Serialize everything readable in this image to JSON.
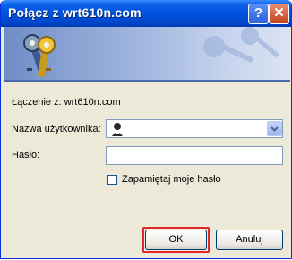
{
  "window": {
    "title": "Połącz z wrt610n.com",
    "help_glyph": "?",
    "close_glyph": "✕"
  },
  "dialog": {
    "connecting_text": "Łączenie z: wrt610n.com",
    "username_label": "Nazwa użytkownika:",
    "password_label": "Hasło:",
    "remember_label": "Zapamiętaj moje hasło",
    "ok_label": "OK",
    "cancel_label": "Anuluj",
    "remember_checked": false
  },
  "colors": {
    "title_bar": "#0053e0",
    "highlight": "#e3262a",
    "dialog_bg": "#ece9d8"
  },
  "icons": {
    "banner": "keys-icon",
    "user": "user-icon",
    "dropdown": "chevron-down-icon"
  }
}
